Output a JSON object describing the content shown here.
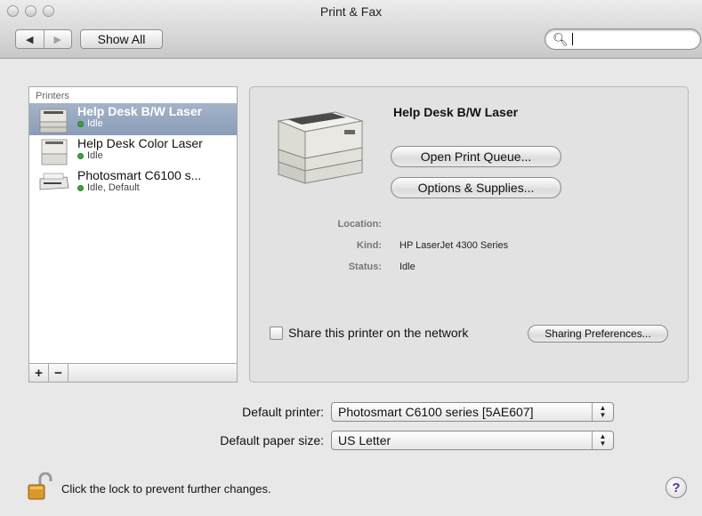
{
  "window": {
    "title": "Print & Fax"
  },
  "toolbar": {
    "back_glyph": "◀",
    "forward_glyph": "▶",
    "show_all_label": "Show All",
    "search_value": ""
  },
  "printer_list": {
    "header": "Printers",
    "items": [
      {
        "name": "Help Desk B/W Laser",
        "status": "Idle",
        "selected": true,
        "icon": "laser-printer-icon"
      },
      {
        "name": "Help Desk Color Laser",
        "status": "Idle",
        "selected": false,
        "icon": "laser-printer-icon"
      },
      {
        "name": "Photosmart C6100 s...",
        "status": "Idle, Default",
        "selected": false,
        "icon": "inkjet-printer-icon"
      }
    ],
    "add_label": "+",
    "remove_label": "−"
  },
  "detail": {
    "printer_name": "Help Desk B/W Laser",
    "open_queue_label": "Open Print Queue...",
    "options_supplies_label": "Options & Supplies...",
    "location_label": "Location:",
    "location_value": "",
    "kind_label": "Kind:",
    "kind_value": "HP LaserJet 4300 Series",
    "status_label": "Status:",
    "status_value": "Idle",
    "share_label": "Share this printer on the network",
    "share_checked": false,
    "sharing_prefs_label": "Sharing Preferences..."
  },
  "defaults": {
    "printer_label": "Default printer:",
    "printer_value": "Photosmart C6100 series [5AE607]",
    "paper_label": "Default paper size:",
    "paper_value": "US Letter"
  },
  "footer": {
    "lock_text": "Click the lock to prevent further changes.",
    "help_label": "?"
  },
  "colors": {
    "selection": "#8a9db8",
    "status_dot": "#3aa53a",
    "help_glyph": "#5a2fa0"
  }
}
